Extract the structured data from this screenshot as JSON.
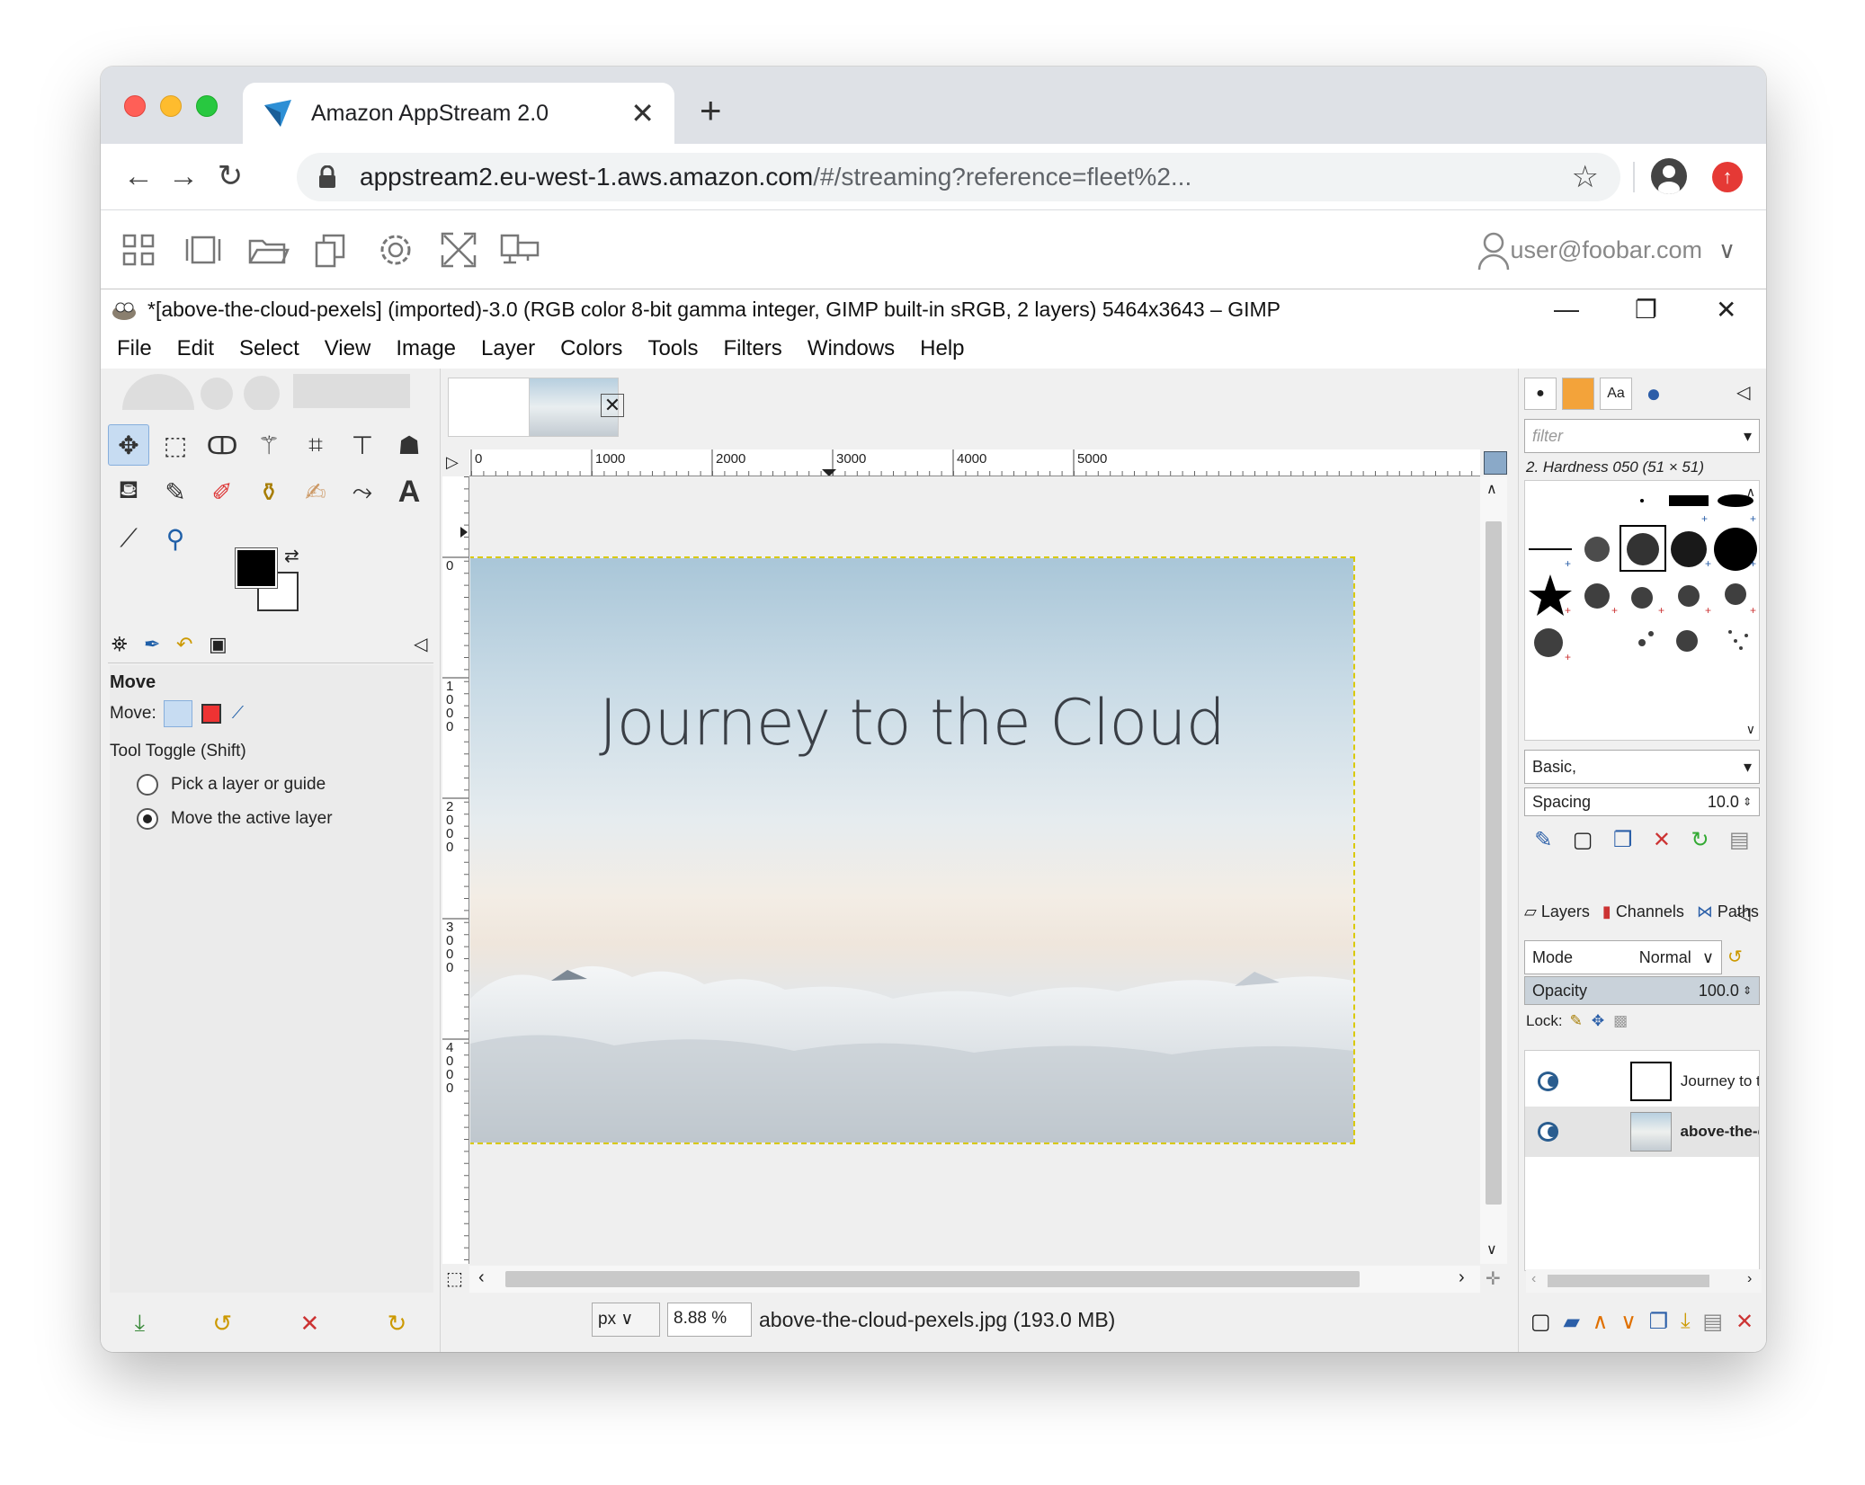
{
  "browser": {
    "tab_title": "Amazon AppStream 2.0",
    "url_host": "appstream2.eu-west-1.aws.amazon.com",
    "url_rest": "/#/streaming?reference=fleet%2...",
    "new_tab_label": "+"
  },
  "appstream": {
    "user": "user@foobar.com",
    "toolbar_icons": [
      "catalog-icon",
      "windows-icon",
      "folder-icon",
      "copy-icon",
      "settings-icon",
      "fullscreen-icon",
      "multi-monitor-icon"
    ]
  },
  "gimp": {
    "title": "*[above-the-cloud-pexels] (imported)-3.0 (RGB color 8-bit gamma integer, GIMP built-in sRGB, 2 layers) 5464x3643 – GIMP",
    "menu": [
      "File",
      "Edit",
      "Select",
      "View",
      "Image",
      "Layer",
      "Colors",
      "Tools",
      "Filters",
      "Windows",
      "Help"
    ],
    "tool_options": {
      "title": "Move",
      "move_label": "Move:",
      "toggle_label": "Tool Toggle  (Shift)",
      "option1": "Pick a layer or guide",
      "option2": "Move the active layer",
      "selected_option": 2
    },
    "ruler_h": [
      "0",
      "1000",
      "2000",
      "3000",
      "4000",
      "5000"
    ],
    "ruler_v": [
      "0",
      "1000",
      "2000",
      "3000",
      "4000"
    ],
    "image_text": "Journey to the Cloud",
    "status": {
      "unit": "px",
      "zoom": "8.88 %",
      "file": "above-the-cloud-pexels.jpg (193.0 MB)"
    },
    "brushes": {
      "filter_placeholder": "filter",
      "current_brush": "2. Hardness 050 (51 × 51)",
      "preset": "Basic,",
      "spacing_label": "Spacing",
      "spacing_value": "10.0"
    },
    "layers_dock": {
      "tabs": [
        "Layers",
        "Channels",
        "Paths"
      ],
      "mode_label": "Mode",
      "mode_value": "Normal",
      "opacity_label": "Opacity",
      "opacity_value": "100.0",
      "lock_label": "Lock:",
      "layers": [
        "Journey to the Cl",
        "above-the-cloud"
      ]
    }
  }
}
